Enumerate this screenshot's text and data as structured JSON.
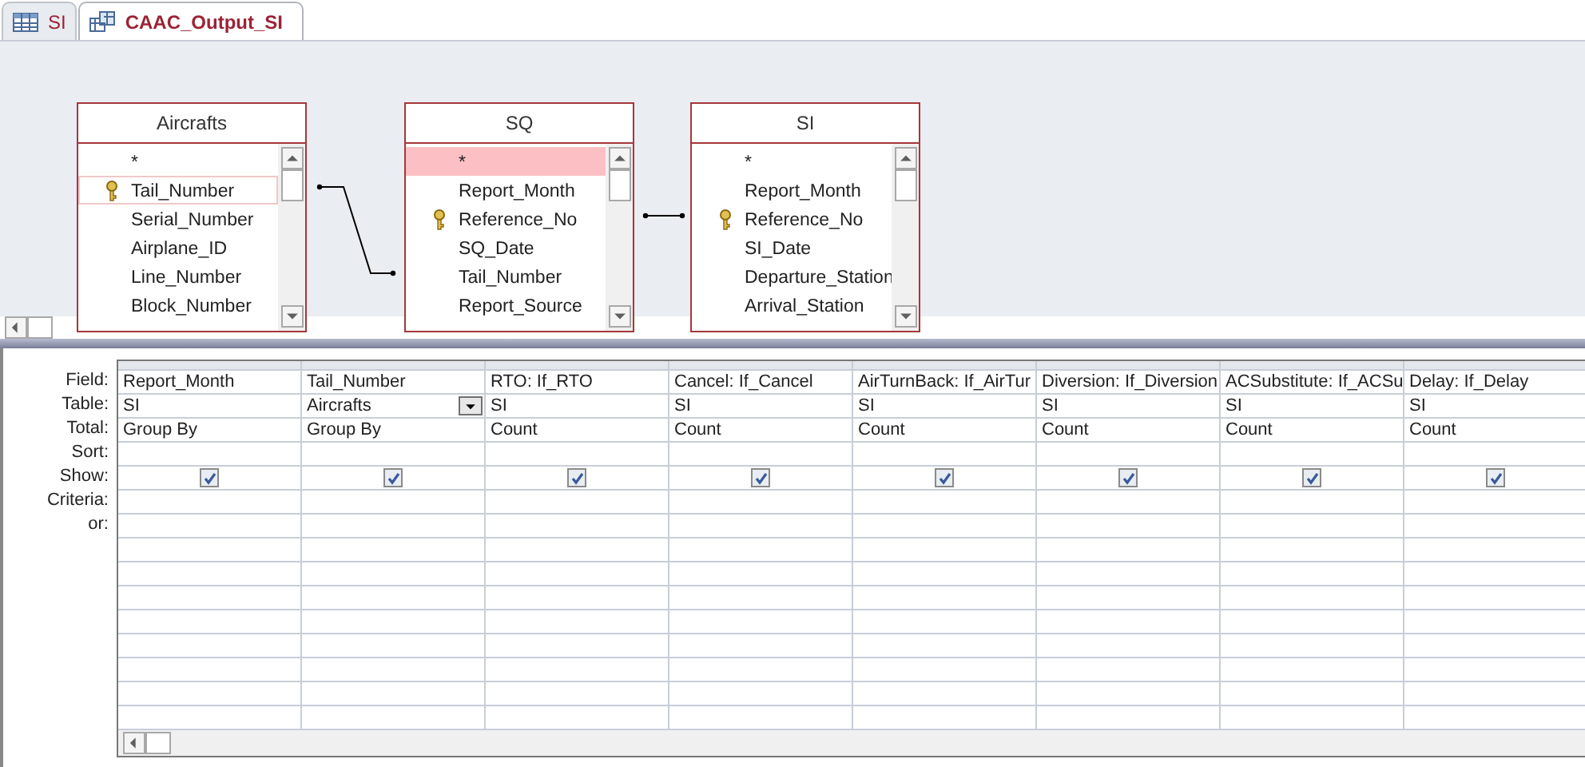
{
  "tabs": [
    {
      "label": "SI",
      "kind": "table",
      "selected": false
    },
    {
      "label": "CAAC_Output_SI",
      "kind": "query",
      "selected": true
    }
  ],
  "field_lists": [
    {
      "title": "Aircrafts",
      "fields": [
        {
          "name": "*",
          "primary_key": false,
          "selected": false,
          "focused": false
        },
        {
          "name": "Tail_Number",
          "primary_key": true,
          "selected": false,
          "focused": true
        },
        {
          "name": "Serial_Number",
          "primary_key": false,
          "selected": false,
          "focused": false
        },
        {
          "name": "Airplane_ID",
          "primary_key": false,
          "selected": false,
          "focused": false
        },
        {
          "name": "Line_Number",
          "primary_key": false,
          "selected": false,
          "focused": false
        },
        {
          "name": "Block_Number",
          "primary_key": false,
          "selected": false,
          "focused": false
        }
      ]
    },
    {
      "title": "SQ",
      "fields": [
        {
          "name": "*",
          "primary_key": false,
          "selected": true,
          "focused": false
        },
        {
          "name": "Report_Month",
          "primary_key": false,
          "selected": false,
          "focused": false
        },
        {
          "name": "Reference_No",
          "primary_key": true,
          "selected": false,
          "focused": false
        },
        {
          "name": "SQ_Date",
          "primary_key": false,
          "selected": false,
          "focused": false
        },
        {
          "name": "Tail_Number",
          "primary_key": false,
          "selected": false,
          "focused": false
        },
        {
          "name": "Report_Source",
          "primary_key": false,
          "selected": false,
          "focused": false
        }
      ]
    },
    {
      "title": "SI",
      "fields": [
        {
          "name": "*",
          "primary_key": false,
          "selected": false,
          "focused": false
        },
        {
          "name": "Report_Month",
          "primary_key": false,
          "selected": false,
          "focused": false
        },
        {
          "name": "Reference_No",
          "primary_key": true,
          "selected": false,
          "focused": false
        },
        {
          "name": "SI_Date",
          "primary_key": false,
          "selected": false,
          "focused": false
        },
        {
          "name": "Departure_Station",
          "primary_key": false,
          "selected": false,
          "focused": false
        },
        {
          "name": "Arrival_Station",
          "primary_key": false,
          "selected": false,
          "focused": false
        }
      ]
    }
  ],
  "grid": {
    "row_labels": [
      "Field:",
      "Table:",
      "Total:",
      "Sort:",
      "Show:",
      "Criteria:",
      "or:"
    ],
    "columns": [
      {
        "field": "Report_Month",
        "table": "SI",
        "total": "Group By",
        "show": true,
        "focused": false
      },
      {
        "field": "Tail_Number",
        "table": "Aircrafts",
        "total": "Group By",
        "show": true,
        "focused": true
      },
      {
        "field": "RTO: If_RTO",
        "table": "SI",
        "total": "Count",
        "show": true,
        "focused": false
      },
      {
        "field": "Cancel: If_Cancel",
        "table": "SI",
        "total": "Count",
        "show": true,
        "focused": false
      },
      {
        "field": "AirTurnBack: If_AirTur",
        "table": "SI",
        "total": "Count",
        "show": true,
        "focused": false
      },
      {
        "field": "Diversion: If_Diversion",
        "table": "SI",
        "total": "Count",
        "show": true,
        "focused": false
      },
      {
        "field": "ACSubstitute: If_ACSu",
        "table": "SI",
        "total": "Count",
        "show": true,
        "focused": false
      },
      {
        "field": "Delay: If_Delay",
        "table": "SI",
        "total": "Count",
        "show": true,
        "focused": false
      }
    ]
  }
}
